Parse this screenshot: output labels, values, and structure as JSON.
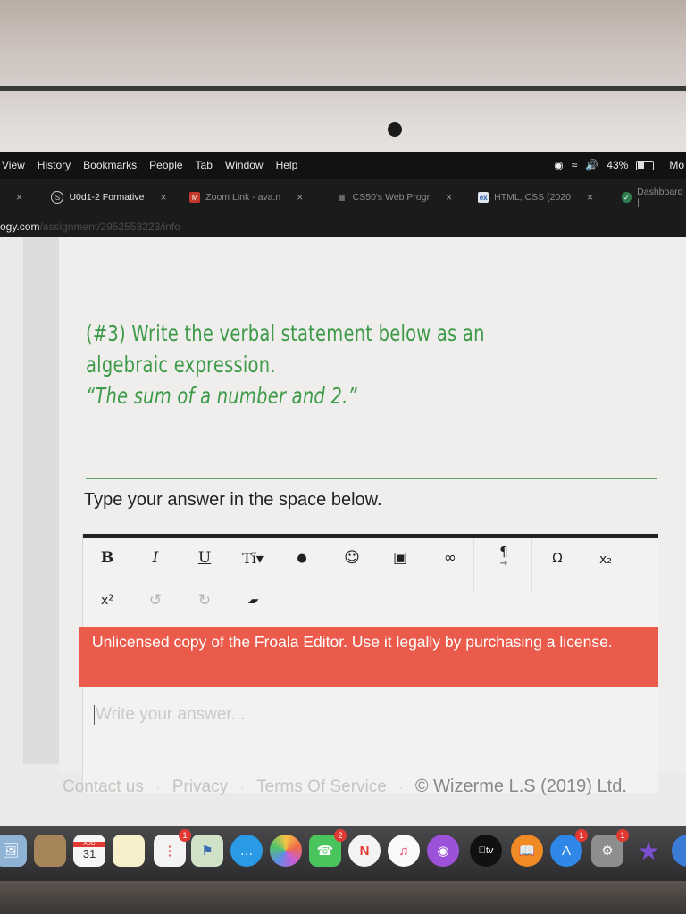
{
  "menubar": {
    "items": [
      "View",
      "History",
      "Bookmarks",
      "People",
      "Tab",
      "Window",
      "Help"
    ],
    "battery_percent": "43%",
    "battery_level": 0.43,
    "clock_partial": "Mo",
    "status_icons": [
      "zoom-camera-icon",
      "wifi-icon",
      "volume-icon",
      "battery-icon"
    ]
  },
  "tabs": [
    {
      "title": "",
      "favicon": "generic",
      "active": false
    },
    {
      "title": "U0d1-2 Formative",
      "favicon": "S",
      "active": true
    },
    {
      "title": "Zoom Link - ava.n",
      "favicon": "gmail",
      "active": false
    },
    {
      "title": "CS50's Web Progr",
      "favicon": "cs50",
      "active": false
    },
    {
      "title": "HTML, CSS (2020",
      "favicon": "edx",
      "active": false
    },
    {
      "title": "Dashboard |",
      "favicon": "check",
      "active": false
    }
  ],
  "url": {
    "host": "ogy.com",
    "path": "/assignment/2952553223/info"
  },
  "question": {
    "lines": [
      "(#3)  Write the verbal statement below as an",
      "algebraic expression.",
      "“The sum of a number and 2.”"
    ]
  },
  "instruction": "Type your answer in the space below.",
  "editor": {
    "toolbar_row1": [
      {
        "name": "bold-button",
        "icon": "B"
      },
      {
        "name": "italic-button",
        "icon": "I"
      },
      {
        "name": "underline-button",
        "icon": "U"
      },
      {
        "name": "font-size-button",
        "icon": "Tĩ▾"
      },
      {
        "name": "text-color-button",
        "icon": "💧"
      },
      {
        "name": "emoticons-button",
        "icon": "☺"
      },
      {
        "name": "insert-image-button",
        "icon": "▣"
      },
      {
        "name": "insert-link-button",
        "icon": "∞"
      },
      {
        "name": "paragraph-format-button",
        "icon": "¶"
      },
      {
        "name": "special-characters-button",
        "icon": "Ω"
      },
      {
        "name": "subscript-button",
        "icon": "x₂"
      }
    ],
    "toolbar_row2": [
      {
        "name": "superscript-button",
        "icon": "x²"
      },
      {
        "name": "undo-button",
        "icon": "↺"
      },
      {
        "name": "redo-button",
        "icon": "↻"
      },
      {
        "name": "clear-formatting-button",
        "icon": "▰"
      }
    ],
    "license_warning": "Unlicensed copy of the Froala Editor. Use it legally by purchasing a license.",
    "answer_placeholder": "Write your answer...",
    "answer_value": ""
  },
  "footer": {
    "links": [
      "Contact us",
      "Privacy",
      "Terms Of Service"
    ],
    "copyright": "© Wizerme L.S (2019) Ltd."
  },
  "dock": {
    "calendar_month": "AUG",
    "calendar_day": "31",
    "apps": [
      {
        "name": "preview",
        "badge": ""
      },
      {
        "name": "contacts",
        "badge": ""
      },
      {
        "name": "calendar",
        "badge": ""
      },
      {
        "name": "notes",
        "badge": ""
      },
      {
        "name": "reminders",
        "badge": "1"
      },
      {
        "name": "maps",
        "badge": ""
      },
      {
        "name": "messages",
        "badge": ""
      },
      {
        "name": "photos",
        "badge": ""
      },
      {
        "name": "facetime",
        "badge": "2"
      },
      {
        "name": "news",
        "badge": ""
      },
      {
        "name": "music",
        "badge": ""
      },
      {
        "name": "podcasts",
        "badge": ""
      },
      {
        "name": "apple-tv",
        "badge": ""
      },
      {
        "name": "books",
        "badge": ""
      },
      {
        "name": "app-store",
        "badge": "1"
      },
      {
        "name": "system-preferences",
        "badge": "1"
      },
      {
        "name": "imovie",
        "badge": ""
      }
    ],
    "tv_label": "tv"
  }
}
